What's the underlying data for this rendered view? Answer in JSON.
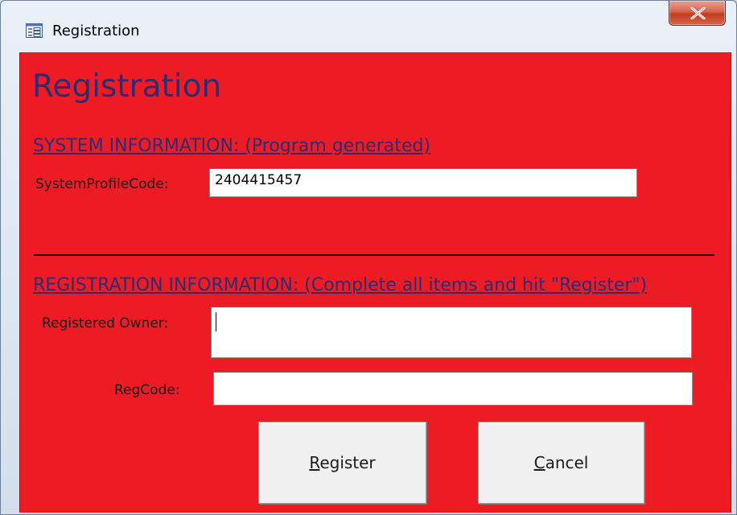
{
  "window": {
    "title": "Registration",
    "icon": "form-window-icon",
    "close_icon": "close-x-icon"
  },
  "form": {
    "heading": "Registration",
    "background_color": "#ed1c24",
    "system_section": {
      "label": "SYSTEM INFORMATION: (Program generated)",
      "system_profile_code_label": "SystemProfileCode:",
      "system_profile_code_value": "2404415457"
    },
    "registration_section": {
      "label": "REGISTRATION INFORMATION: (Complete all items and hit \"Register\")",
      "registered_owner_label": "Registered Owner:",
      "registered_owner_value": "",
      "regcode_label": "RegCode:",
      "regcode_value": ""
    },
    "buttons": {
      "register": {
        "label_first": "R",
        "label_rest": "egister"
      },
      "cancel": {
        "label_first": "C",
        "label_rest": "ancel"
      }
    }
  }
}
